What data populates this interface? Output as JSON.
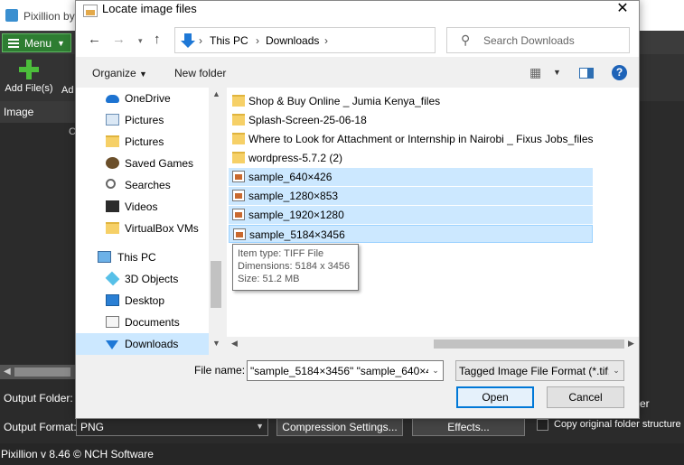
{
  "app": {
    "title": "Pixillion by",
    "menu_label": "Menu",
    "add_files_label": "Add File(s)",
    "add_fragment": "Ad",
    "image_panel_label": "Image",
    "c_fragment": "C",
    "output_folder_label": "Output Folder:",
    "output_format_label": "Output Format:",
    "output_format_value": "PNG",
    "compression_button": "Compression Settings...",
    "effects_button": "Effects...",
    "er_fragment": "er",
    "copy_structure_label": "Copy original folder structure",
    "status": "Pixillion v 8.46 © NCH Software"
  },
  "dialog": {
    "title": "Locate image files",
    "breadcrumb": [
      "This PC",
      "Downloads"
    ],
    "search_placeholder": "Search Downloads",
    "organize_label": "Organize",
    "new_folder_label": "New folder",
    "nav_items": [
      {
        "label": "OneDrive",
        "icon": "cloud-icon"
      },
      {
        "label": "Pictures",
        "icon": "pictures-icon"
      },
      {
        "label": "Pictures",
        "icon": "folder-icon"
      },
      {
        "label": "Saved Games",
        "icon": "games-icon"
      },
      {
        "label": "Searches",
        "icon": "search-icon"
      },
      {
        "label": "Videos",
        "icon": "video-icon"
      },
      {
        "label": "VirtualBox VMs",
        "icon": "folder-icon"
      },
      {
        "label": "This PC",
        "icon": "pc-icon"
      },
      {
        "label": "3D Objects",
        "icon": "3d-objects-icon"
      },
      {
        "label": "Desktop",
        "icon": "desktop-icon"
      },
      {
        "label": "Documents",
        "icon": "documents-icon"
      },
      {
        "label": "Downloads",
        "icon": "downloads-icon"
      }
    ],
    "files": [
      {
        "name": "Shop & Buy Online _ Jumia Kenya_files",
        "type": "folder"
      },
      {
        "name": "Splash-Screen-25-06-18",
        "type": "folder"
      },
      {
        "name": "Where to Look for Attachment or Internship in Nairobi _ Fixus Jobs_files",
        "type": "folder"
      },
      {
        "name": "wordpress-5.7.2 (2)",
        "type": "folder"
      },
      {
        "name": "sample_640×426",
        "type": "image"
      },
      {
        "name": "sample_1280×853",
        "type": "image"
      },
      {
        "name": "sample_1920×1280",
        "type": "image"
      },
      {
        "name": "sample_5184×3456",
        "type": "image"
      }
    ],
    "tooltip": {
      "type": "Item type: TIFF File",
      "dimensions": "Dimensions: 5184 x 3456",
      "size": "Size: 51.2 MB"
    },
    "file_name_label": "File name:",
    "file_name_value": "\"sample_5184×3456\" \"sample_640×4",
    "file_type_value": "Tagged Image File Format (*.tif;",
    "open_label": "Open",
    "cancel_label": "Cancel"
  },
  "colors": {
    "selection": "#cce8ff",
    "accent": "#0078d7",
    "menu_green": "#2e7d32"
  }
}
